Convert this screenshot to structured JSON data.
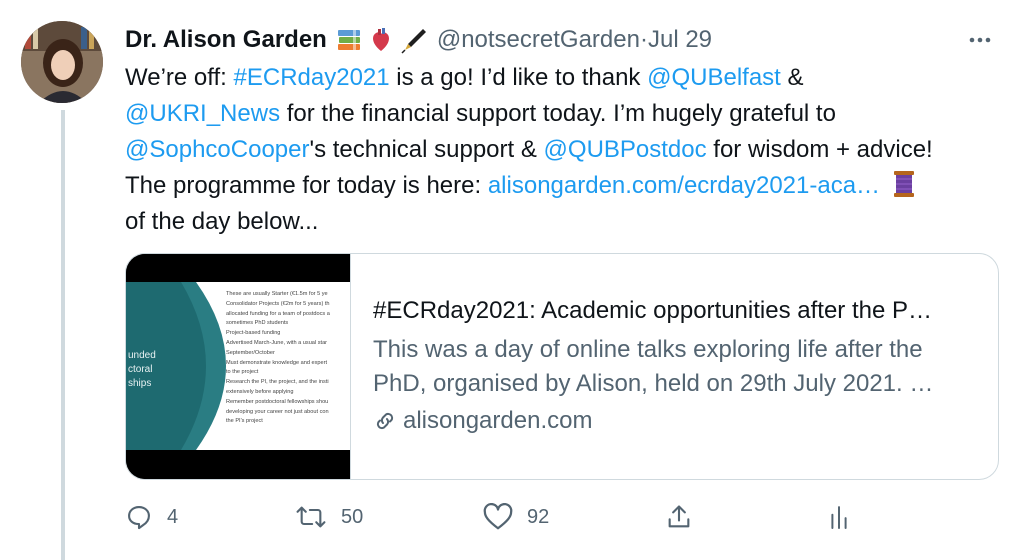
{
  "tweet": {
    "author_name": "Dr. Alison Garden",
    "name_emojis": [
      "books-emoji",
      "anatomical-heart-emoji",
      "fountain-pen-emoji"
    ],
    "handle": "@notsecretGarden",
    "separator": " · ",
    "date": "Jul 29",
    "text": {
      "l1_a": "We’re off: ",
      "l1_tag": "#ECRday2021",
      "l1_b": " is a go! I’d like to thank ",
      "l1_mention": "@QUBelfast",
      "l1_c": " &",
      "l2_mention": "@UKRI_News",
      "l2_b": " for the financial support today. I’m hugely grateful to",
      "l3_mention": "@SophcoCooper",
      "l3_b": "'s technical support & ",
      "l3_mention2": "@QUBPostdoc",
      "l3_c": " for wisdom + advice!",
      "l4_a": "The programme for today is here: ",
      "l4_link": "alisongarden.com/ecrday2021-aca…",
      "l5": "of the day below..."
    },
    "card": {
      "title": "#ECRday2021: Academic opportunities after the P…",
      "desc_line1": "This was a day of online talks exploring life after the",
      "desc_line2": "PhD, organised by Alison, held on 29th July 2021. …",
      "domain": "alisongarden.com",
      "thumb_side_text": [
        "unded",
        "ctoral",
        "ships"
      ],
      "thumb_bullets": [
        "These are usually Starter (€1.5m for 5 ye",
        "Consolidator Projects (€2m for 5 years) th",
        "allocated funding for a team of postdocs a",
        "sometimes PhD students",
        "Project-based funding",
        "Advertised March-June, with a usual star",
        "September/October",
        "Must demonstrate knowledge and expert",
        "to the project",
        "Research the PI, the project, and the insti",
        "extensively before applying",
        "Remember postdoctoral fellowships shou",
        "developing your career not just about con",
        "the PI's project"
      ]
    },
    "actions": {
      "reply_count": "4",
      "retweet_count": "50",
      "like_count": "92"
    }
  },
  "colors": {
    "link": "#1d9bf0",
    "muted": "#536471",
    "thread": "#cfd9de",
    "teal": "#2a7d83"
  }
}
